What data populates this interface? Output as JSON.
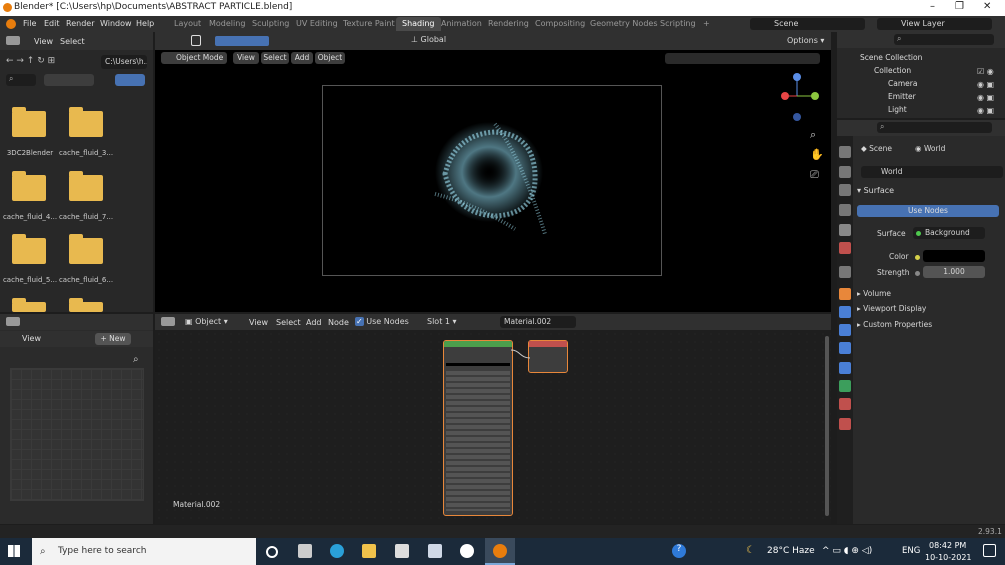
{
  "window": {
    "title": "Blender* [C:\\Users\\hp\\Documents\\ABSTRACT PARTICLE.blend]",
    "minimize": "–",
    "maximize": "❐",
    "close": "✕"
  },
  "menubar": {
    "items": [
      "File",
      "Edit",
      "Render",
      "Window",
      "Help"
    ]
  },
  "workspaces": {
    "tabs": [
      "Layout",
      "Modeling",
      "Sculpting",
      "UV Editing",
      "Texture Paint",
      "Shading",
      "Animation",
      "Rendering",
      "Compositing",
      "Geometry Nodes",
      "Scripting"
    ],
    "active": "Shading",
    "add": "+"
  },
  "scene": {
    "label": "Scene",
    "view_layer": "View Layer"
  },
  "filebrowser": {
    "menu": [
      "View",
      "Select"
    ],
    "path": "C:\\Users\\h...",
    "items": [
      "3DC2Blender",
      "cache_fluid_3...",
      "cache_fluid_4...",
      "cache_fluid_7...",
      "cache_fluid_5...",
      "cache_fluid_6..."
    ]
  },
  "viewport": {
    "mode": "Object Mode",
    "menu": [
      "View",
      "Select",
      "Add",
      "Object"
    ],
    "transform": "Global",
    "options": "Options"
  },
  "outliner": {
    "title": "Scene Collection",
    "items": [
      "Collection",
      "Camera",
      "Emitter",
      "Light"
    ]
  },
  "properties": {
    "scene_tab": "Scene",
    "world_tab": "World",
    "world_name": "World",
    "surface_header": "Surface",
    "use_nodes": "Use Nodes",
    "surface_label": "Surface",
    "surface_value": "Background",
    "color_label": "Color",
    "strength_label": "Strength",
    "strength_value": "1.000",
    "collapsed": [
      "Volume",
      "Viewport Display",
      "Custom Properties"
    ]
  },
  "nodeeditor": {
    "object": "Object",
    "menu": [
      "View",
      "Select",
      "Add",
      "Node"
    ],
    "use_nodes": "Use Nodes",
    "slot": "Slot 1",
    "material": "Material.002",
    "footer_label": "Material.002"
  },
  "imageeditor": {
    "view": "View",
    "new": "New"
  },
  "statusbar": {
    "version": "2.93.1"
  },
  "taskbar": {
    "search": "Type here to search",
    "weather": "28°C Haze",
    "lang": "ENG",
    "time": "08:42 PM",
    "date": "10-10-2021"
  }
}
